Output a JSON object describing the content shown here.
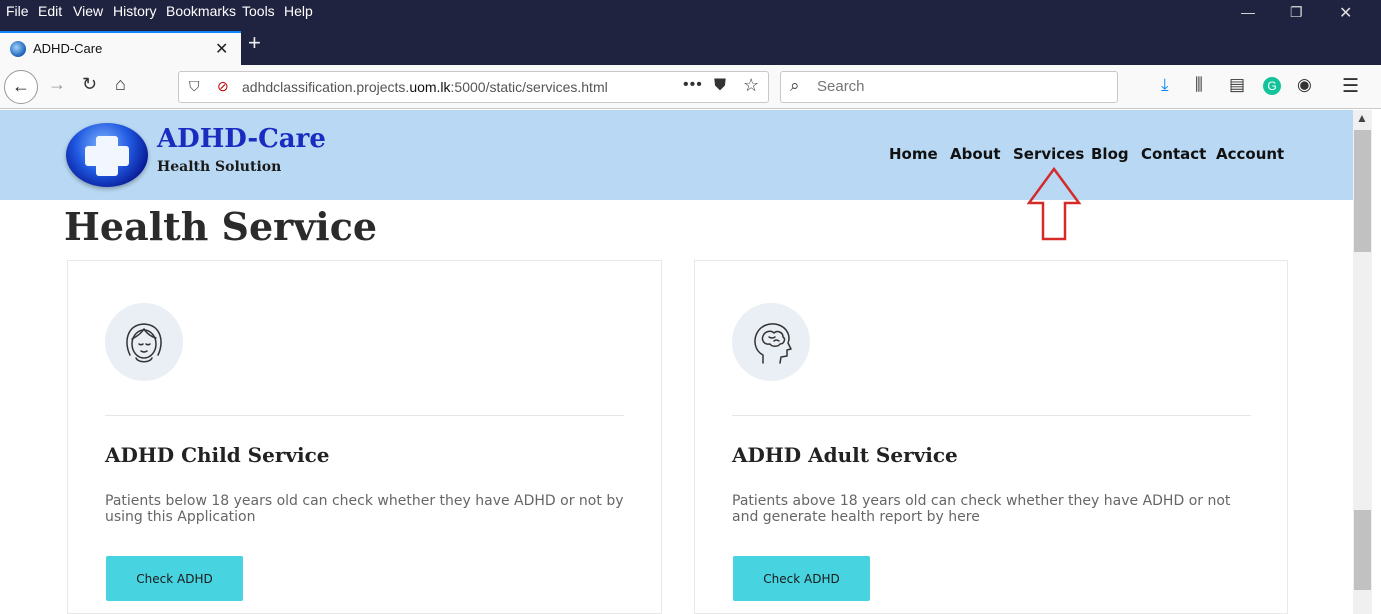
{
  "browser": {
    "menu": [
      "File",
      "Edit",
      "View",
      "History",
      "Bookmarks",
      "Tools",
      "Help"
    ],
    "tab_title": "ADHD-Care",
    "url_prefix": "adhdclassification.projects.",
    "url_domain": "uom.lk",
    "url_suffix": ":5000/static/services.html",
    "search_placeholder": "Search",
    "window_controls": {
      "minimize": "—",
      "restore": "❐",
      "close": "✕"
    }
  },
  "site": {
    "logo_title": "ADHD-Care",
    "logo_subtitle": "Health Solution",
    "nav": [
      "Home",
      "About",
      "Services",
      "Blog",
      "Contact",
      "Account"
    ]
  },
  "page": {
    "title": "Health Service",
    "cards": [
      {
        "title": "ADHD Child Service",
        "text": "Patients below 18 years old can check whether they have ADHD or not by using this Application",
        "button": "Check ADHD",
        "icon": "girl-face-icon"
      },
      {
        "title": "ADHD Adult Service",
        "text": "Patients above 18 years old can check whether they have ADHD or not and generate health report by here",
        "button": "Check ADHD",
        "icon": "brain-head-icon"
      }
    ]
  },
  "annotation": {
    "color": "#d42a2a",
    "icon": "up-arrow-icon"
  }
}
